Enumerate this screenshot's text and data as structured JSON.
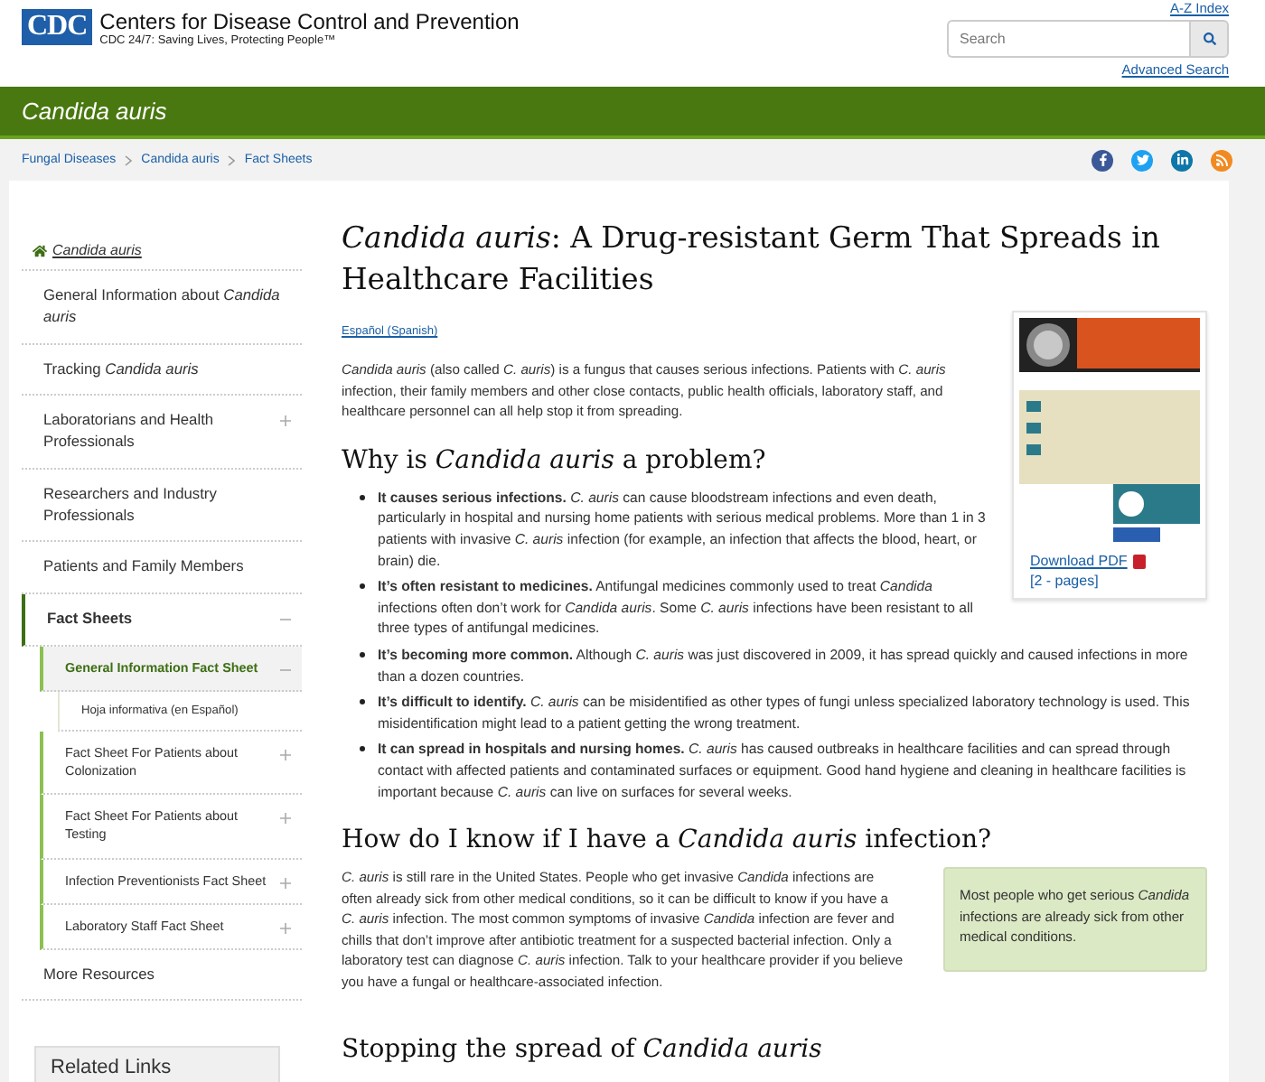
{
  "header": {
    "logo": "CDC",
    "org_name": "Centers for Disease Control and Prevention",
    "tagline": "CDC 24/7: Saving Lives, Protecting People™",
    "az_index": "A-Z Index",
    "search": {
      "placeholder": "Search"
    },
    "advanced_search": "Advanced Search"
  },
  "banner": {
    "title": "Candida auris"
  },
  "breadcrumbs": [
    "Fungal Diseases",
    "Candida auris",
    "Fact Sheets"
  ],
  "sidebar": {
    "home": "Candida auris",
    "items": [
      {
        "label": "General Information about *Candida auris*",
        "expandable": false,
        "expanded": false,
        "selected": false
      },
      {
        "label": "Tracking *Candida auris*",
        "expandable": false,
        "expanded": false,
        "selected": false
      },
      {
        "label": "Laboratorians and Health Professionals",
        "expandable": true,
        "expanded": false,
        "selected": false
      },
      {
        "label": "Researchers and Industry Professionals",
        "expandable": false,
        "expanded": false,
        "selected": false
      },
      {
        "label": "Patients and Family Members",
        "expandable": false,
        "expanded": false,
        "selected": false
      },
      {
        "label": "Fact Sheets",
        "expandable": true,
        "expanded": true,
        "selected": false,
        "children": [
          {
            "label": "General Information Fact Sheet",
            "expandable": true,
            "expanded": true,
            "selected": true,
            "children": [
              {
                "label": "Hoja informativa (en Español)",
                "expandable": false,
                "expanded": false,
                "selected": false
              }
            ]
          },
          {
            "label": "Fact Sheet For Patients about Colonization",
            "expandable": true,
            "expanded": false,
            "selected": false
          },
          {
            "label": "Fact Sheet For Patients about Testing",
            "expandable": true,
            "expanded": false,
            "selected": false
          },
          {
            "label": "Infection Preventionists Fact Sheet",
            "expandable": true,
            "expanded": false,
            "selected": false
          },
          {
            "label": "Laboratory Staff Fact Sheet",
            "expandable": true,
            "expanded": false,
            "selected": false
          }
        ]
      },
      {
        "label": "More Resources",
        "expandable": false,
        "expanded": false,
        "selected": false
      }
    ],
    "related_links": {
      "title": "Related Links"
    }
  },
  "main": {
    "title": "*Candida auris*: A Drug-resistant Germ That Spreads in Healthcare Facilities",
    "language_link": "Español (Spanish)",
    "intro": "*Candida auris* (also called *C. auris*) is a fungus that causes serious infections. Patients with *C. auris* infection, their family members and other close contacts, public health officials, laboratory staff, and healthcare personnel can all help stop it from spreading.",
    "figure": {
      "kind": "picture",
      "download": "Download PDF",
      "pages": "[2 - pages]"
    },
    "sections": [
      {
        "heading": "Why is *Candida auris* a problem?",
        "bullets": [
          "**It causes serious infections.** *C. auris* can cause bloodstream infections and even death, particularly in hospital and nursing home patients with serious medical problems. More than 1 in 3 patients with invasive *C. auris* infection (for example, an infection that affects the blood, heart, or brain) die.",
          "**It’s often resistant to medicines.** Antifungal medicines commonly used to treat *Candida* infections often don’t work for *Candida auris*. Some *C. auris* infections have been resistant to all three types of antifungal medicines.",
          "**It’s becoming more common.** Although *C. auris* was just discovered in 2009, it has spread quickly and caused infections in more than a dozen countries.",
          "**It’s difficult to identify.** *C. auris* can be misidentified as other types of fungi unless specialized laboratory technology is used. This misidentification might lead to a patient getting the wrong treatment.",
          "**It can spread in hospitals and nursing homes.** *C. auris* has caused outbreaks in healthcare facilities and can spread through contact with affected patients and contaminated surfaces or equipment. Good hand hygiene and cleaning in healthcare facilities is important because *C. auris* can live on surfaces for several weeks."
        ]
      },
      {
        "heading": "How do I know if I have a *Candida auris* infection?",
        "paragraph": "*C. auris* is still rare in the United States. People who get invasive *Candida* infections are often already sick from other medical conditions, so it can be difficult to know if you have a *C. auris* infection. The most common symptoms of invasive *Candida* infection are fever and chills that don’t improve after antibiotic treatment for a suspected bacterial infection. Only a laboratory test can diagnose *C. auris* infection. Talk to your healthcare provider if you believe you have a fungal or healthcare-associated infection.",
        "callout": "Most people who get serious *Candida* infections are already sick from other medical conditions."
      },
      {
        "heading": "Stopping the spread of *Candida auris*"
      }
    ]
  }
}
